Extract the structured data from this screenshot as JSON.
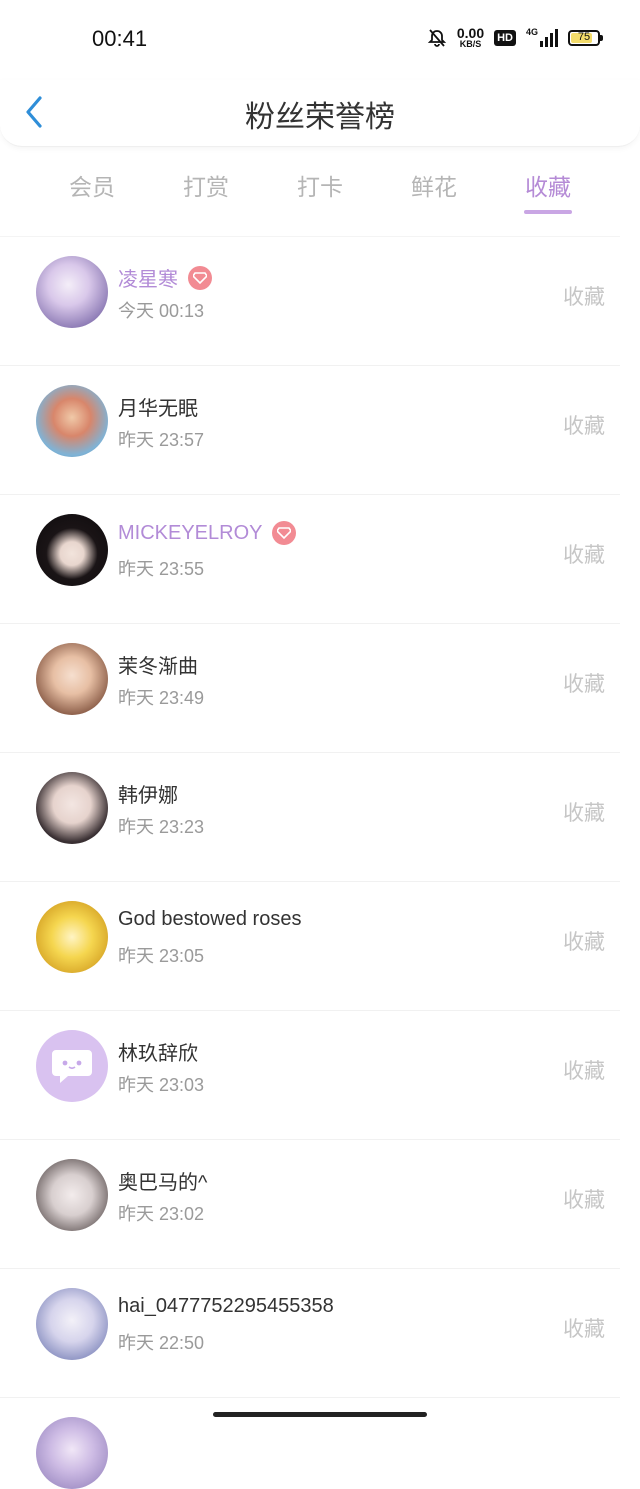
{
  "status": {
    "time": "00:41",
    "speed_value": "0.00",
    "speed_unit": "KB/S",
    "hd": "HD",
    "network": "4G",
    "battery": "75"
  },
  "header": {
    "title": "粉丝荣誉榜"
  },
  "tabs": [
    {
      "label": "会员",
      "active": false
    },
    {
      "label": "打赏",
      "active": false
    },
    {
      "label": "打卡",
      "active": false
    },
    {
      "label": "鲜花",
      "active": false
    },
    {
      "label": "收藏",
      "active": true
    }
  ],
  "fans": [
    {
      "name": "凌星寒",
      "vip": true,
      "time": "今天 00:13",
      "action": "收藏"
    },
    {
      "name": "月华无眠",
      "vip": false,
      "time": "昨天 23:57",
      "action": "收藏"
    },
    {
      "name": "MICKEYELROY",
      "vip": true,
      "time": "昨天 23:55",
      "action": "收藏"
    },
    {
      "name": "茉冬渐曲",
      "vip": false,
      "time": "昨天 23:49",
      "action": "收藏"
    },
    {
      "name": "韩伊娜",
      "vip": false,
      "time": "昨天 23:23",
      "action": "收藏"
    },
    {
      "name": "God bestowed roses",
      "vip": false,
      "time": "昨天 23:05",
      "action": "收藏"
    },
    {
      "name": "林玖辞欣",
      "vip": false,
      "time": "昨天 23:03",
      "action": "收藏"
    },
    {
      "name": "奥巴马的^",
      "vip": false,
      "time": "昨天 23:02",
      "action": "收藏"
    },
    {
      "name": "hai_0477752295455358",
      "vip": false,
      "time": "昨天 22:50",
      "action": "收藏"
    }
  ],
  "colors": {
    "accent": "#b58bd6",
    "vip_badge": "#f28b93",
    "inactive_tab": "#b5b5b5"
  }
}
